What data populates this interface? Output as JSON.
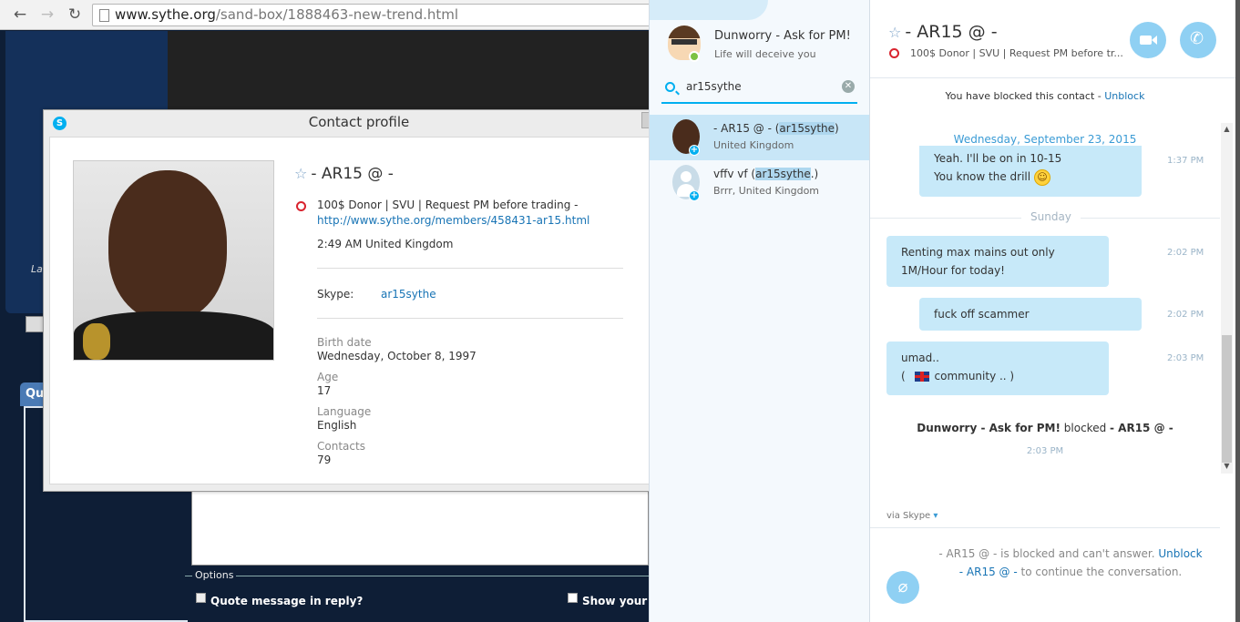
{
  "browser": {
    "url_host": "www.sythe.org",
    "url_path": "/sand-box/1888463-new-trend.html",
    "forum_la": "La",
    "forum_qu": "Qu",
    "options_label": "Options",
    "quote_label": "Quote message in reply?",
    "show_label": "Show your s"
  },
  "profile": {
    "title": "Contact profile",
    "name": "- AR15 @  -",
    "mood": "100$ Donor | SVU | Request PM before trading -",
    "link": "http://www.sythe.org/members/458431-ar15.html",
    "local_time": "2:49 AM United Kingdom",
    "skype_label": "Skype:",
    "skype_value": "ar15sythe",
    "fields": [
      {
        "label": "Birth date",
        "value": "Wednesday, October 8, 1997"
      },
      {
        "label": "Age",
        "value": "17"
      },
      {
        "label": "Language",
        "value": "English"
      },
      {
        "label": "Contacts",
        "value": "79"
      }
    ]
  },
  "sidebar": {
    "my_name": "Dunworry - Ask for PM!",
    "my_mood": "Life will deceive you",
    "search_value": "ar15sythe",
    "contacts": [
      {
        "name_pre": "- AR15 @  - (",
        "name_hl": "ar15sythe",
        "name_post": ")",
        "sub": "United Kingdom"
      },
      {
        "name_pre": "vffv vf (",
        "name_hl": "ar15sythe",
        "name_post": ".)",
        "sub": "Brrr, United Kingdom"
      }
    ]
  },
  "conversation": {
    "name": "- AR15 @  -",
    "mood": "100$ Donor | SVU | Request PM before tr...",
    "blocked_text": "You have blocked this contact - ",
    "unblock_label": "Unblock",
    "date_divider": "Wednesday, September 23, 2015",
    "messages": [
      {
        "line1": "Yeah. I'll be on in 10-15",
        "line2": "You know the drill",
        "time": "1:37 PM"
      },
      {
        "line1": "Renting max mains out only",
        "line2": "1M/Hour for today!",
        "time": "2:02 PM"
      },
      {
        "line1": "fuck off scammer",
        "time": "2:02 PM"
      },
      {
        "line1": "umad..",
        "line2_pre": "( ",
        "line2_post": "community .. )",
        "time": "2:03 PM"
      }
    ],
    "day_label": "Sunday",
    "system": {
      "actor": "Dunworry - Ask for PM!",
      "verb": " blocked ",
      "target": "- AR15 @  -",
      "time": "2:03 PM"
    },
    "via": "via Skype",
    "cant_answer_line1": "- AR15 @  - is blocked and can't answer. ",
    "cant_answer_unblock": "Unblock",
    "cant_answer_line2_name": "- AR15 @  -",
    "cant_answer_line2_rest": " to continue the conversation."
  },
  "colors": {
    "skype_blue": "#00aff0",
    "bubble": "#c7e9f9",
    "link": "#1874b5",
    "forum_navy": "#0e1e36"
  }
}
